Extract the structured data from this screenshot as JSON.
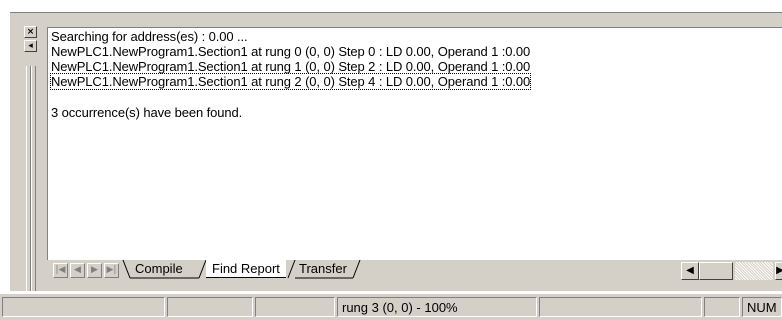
{
  "output": {
    "lines": [
      "Searching for address(es) : 0.00 ...",
      "NewPLC1.NewProgram1.Section1 at rung 0 (0, 0) Step 0 : LD 0.00, Operand 1 :0.00",
      "NewPLC1.NewProgram1.Section1 at rung 1 (0, 0) Step 2 : LD 0.00, Operand 1 :0.00",
      "NewPLC1.NewProgram1.Section1 at rung 2 (0, 0) Step 4 : LD 0.00, Operand 1 :0.00",
      "3 occurrence(s) have been found."
    ],
    "selected_line_index": 3
  },
  "window_controls": {
    "close_glyph": "×",
    "pin_glyph": "◂"
  },
  "tabs": [
    {
      "label": "Compile",
      "active": false
    },
    {
      "label": "Find Report",
      "active": true
    },
    {
      "label": "Transfer",
      "active": false
    }
  ],
  "tab_nav": {
    "first": "|◀",
    "prev": "◀",
    "next": "▶",
    "last": "▶|"
  },
  "hscroll": {
    "left": "◀",
    "right": "▶"
  },
  "status_bar": {
    "panels": [
      "",
      "",
      "rung 3 (0, 0)  - 100%",
      "",
      "",
      "NUM"
    ]
  },
  "colors": {
    "chrome": "#d4d0c8",
    "background": "#ffffff",
    "shadow": "#808080"
  }
}
